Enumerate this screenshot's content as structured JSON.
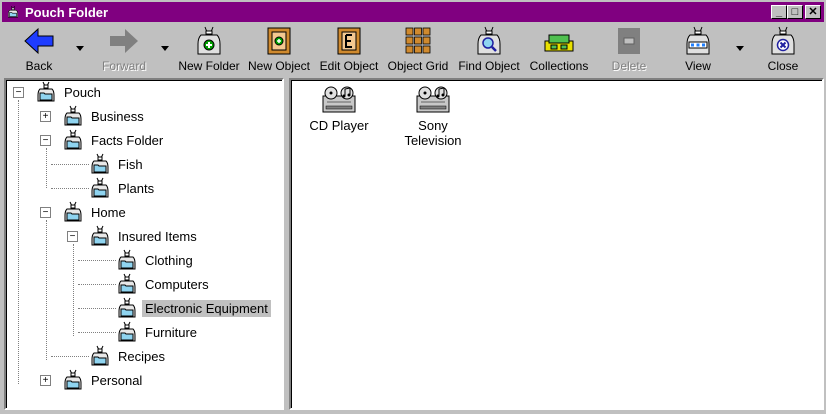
{
  "window": {
    "title": "Pouch Folder"
  },
  "title_buttons": {
    "minimize": "_",
    "maximize": "□",
    "close": "✕"
  },
  "toolbar": {
    "back": "Back",
    "forward": "Forward",
    "new_folder": "New Folder",
    "new_object": "New Object",
    "edit_object": "Edit Object",
    "object_grid": "Object Grid",
    "find_object": "Find Object",
    "collections": "Collections",
    "delete": "Delete",
    "view": "View",
    "close": "Close"
  },
  "tree": {
    "pouch": "Pouch",
    "business": "Business",
    "facts_folder": "Facts Folder",
    "fish": "Fish",
    "plants": "Plants",
    "home": "Home",
    "insured_items": "Insured Items",
    "clothing": "Clothing",
    "computers": "Computers",
    "electronic_equipment": "Electronic Equipment",
    "furniture": "Furniture",
    "recipes": "Recipes",
    "personal": "Personal"
  },
  "objects": {
    "cd_player_line1": "CD Player",
    "sony_line1": "Sony",
    "sony_line2": "Television"
  },
  "colors": {
    "titlebar": "#800080",
    "face": "#c0c0c0",
    "back_arrow": "#1e3cff",
    "pouch_fill": "#8fd4f0"
  }
}
